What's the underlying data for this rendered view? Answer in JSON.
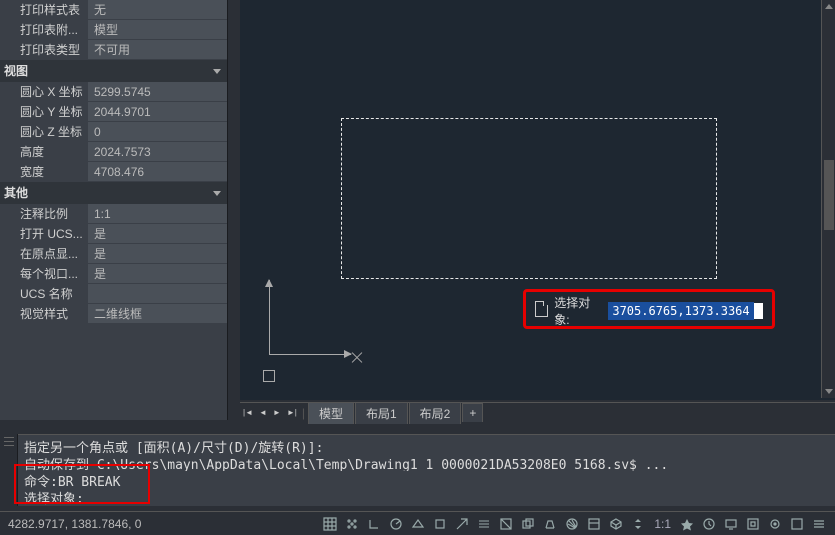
{
  "props": {
    "printStyle": {
      "label": "打印样式表",
      "value": "无"
    },
    "printAttach": {
      "label": "打印表附...",
      "value": "模型"
    },
    "printType": {
      "label": "打印表类型",
      "value": "不可用"
    }
  },
  "catView": "视图",
  "view": {
    "cx": {
      "label": "圆心 X 坐标",
      "value": "5299.5745"
    },
    "cy": {
      "label": "圆心 Y 坐标",
      "value": "2044.9701"
    },
    "cz": {
      "label": "圆心 Z 坐标",
      "value": "0"
    },
    "h": {
      "label": "高度",
      "value": "2024.7573"
    },
    "w": {
      "label": "宽度",
      "value": "4708.476"
    }
  },
  "catOther": "其他",
  "other": {
    "annoscale": {
      "label": "注释比例",
      "value": "1:1"
    },
    "openucs": {
      "label": "打开 UCS...",
      "value": "是"
    },
    "atOrigin": {
      "label": "在原点显...",
      "value": "是"
    },
    "perViewport": {
      "label": "每个视口...",
      "value": "是"
    },
    "ucsName": {
      "label": "UCS 名称",
      "value": ""
    },
    "visualStyle": {
      "label": "视觉样式",
      "value": "二维线框"
    }
  },
  "tooltip": {
    "label": "选择对象:",
    "value": "3705.6765,1373.3364"
  },
  "tabs": {
    "model": "模型",
    "layout1": "布局1",
    "layout2": "布局2",
    "plus": "+"
  },
  "cmd": {
    "l1": "指定另一个角点或 [面积(A)/尺寸(D)/旋转(R)]:",
    "l2": "自动保存到 C:\\Users\\mayn\\AppData\\Local\\Temp\\Drawing1_1_0000021DA53208E0_5168.sv$ ...",
    "l3": "命令:BR BREAK",
    "l4": "选择对象:"
  },
  "status": {
    "coords": "4282.9717, 1381.7846, 0",
    "scale": "1:1"
  }
}
